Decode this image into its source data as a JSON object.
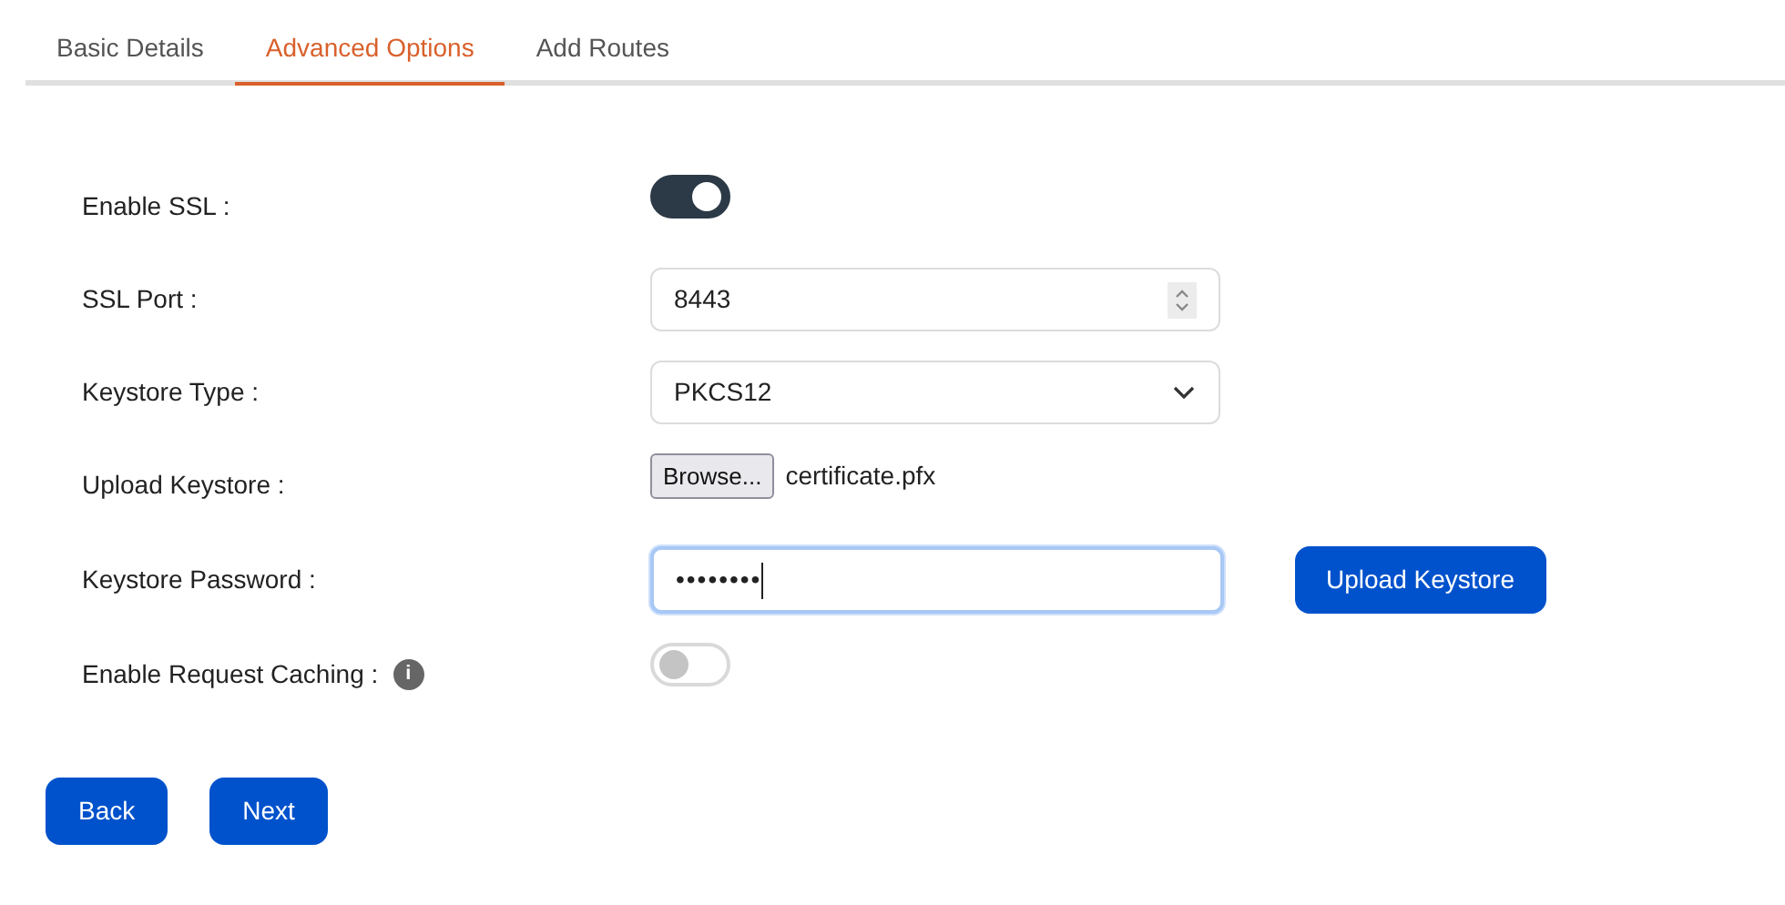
{
  "tabs": [
    {
      "label": "Basic Details",
      "selected": false
    },
    {
      "label": "Advanced Options",
      "selected": true
    },
    {
      "label": "Add Routes",
      "selected": false
    }
  ],
  "fields": [
    {
      "kind": "toggle",
      "label": "Enable SSL :",
      "on": true
    },
    {
      "kind": "number",
      "label": "SSL Port :",
      "value": "8443"
    },
    {
      "kind": "select",
      "label": "Keystore Type :",
      "value": "PKCS12"
    },
    {
      "kind": "file",
      "label": "Upload Keystore :",
      "button": "Browse...",
      "file": "certificate.pfx"
    },
    {
      "kind": "password",
      "label": "Keystore Password :",
      "value": "••••••••",
      "focused": true,
      "action": "Upload Keystore"
    },
    {
      "kind": "toggle",
      "label": "Enable Request Caching :",
      "on": false,
      "info": "i"
    }
  ],
  "buttons": [
    "Back",
    "Next"
  ]
}
